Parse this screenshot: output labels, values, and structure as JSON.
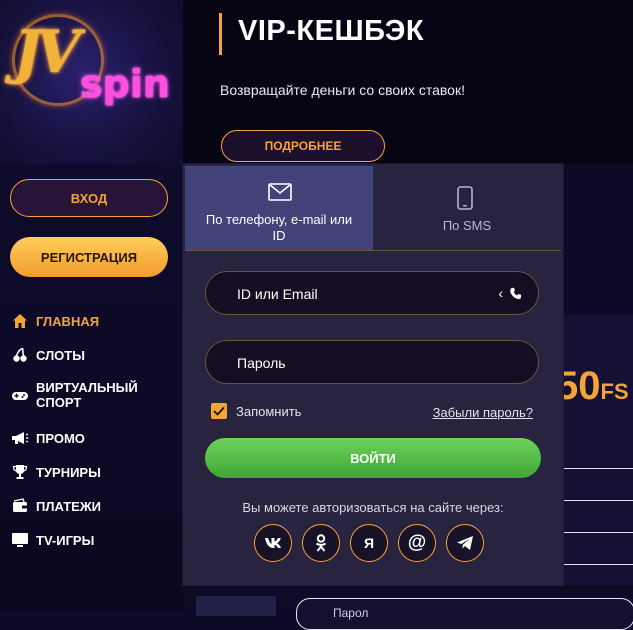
{
  "logo": {
    "letters": "JV",
    "word": "spin"
  },
  "banner": {
    "title": "VIP-КЕШБЭК",
    "text": "Возвращайте деньги со своих ставок!",
    "button": "ПОДРОБНЕЕ"
  },
  "sidebar": {
    "login": "ВХОД",
    "register": "РЕГИСТРАЦИЯ",
    "items": [
      {
        "label": "ГЛАВНАЯ",
        "icon": "home-icon"
      },
      {
        "label": "СЛОТЫ",
        "icon": "cherries-icon"
      },
      {
        "label": "ВИРТУАЛЬНЫЙ",
        "label2": "СПОРТ",
        "icon": "gamepad-icon"
      },
      {
        "label": "ПРОМО",
        "icon": "megaphone-icon"
      },
      {
        "label": "ТУРНИРЫ",
        "icon": "trophy-icon"
      },
      {
        "label": "ПЛАТЕЖИ",
        "icon": "wallet-icon"
      },
      {
        "label": "TV-ИГРЫ",
        "icon": "tv-icon"
      }
    ]
  },
  "modal": {
    "tabs": [
      {
        "line1": "По телефону, e-mail или",
        "line2": "ID"
      },
      {
        "label": "По SMS"
      }
    ],
    "id_placeholder": "ID или Email",
    "id_suffix": "‹",
    "password_placeholder": "Пароль",
    "remember": "Запомнить",
    "forgot": "Забыли пароль?",
    "submit": "ВОЙТИ",
    "social_text": "Вы можете авторизоваться на сайте через:",
    "socials": [
      "vk",
      "ok",
      "Я",
      "@",
      "telegram"
    ]
  },
  "promo": {
    "fs_number": "50",
    "fs_unit": "FS"
  },
  "bottom": {
    "field_text": "Парол"
  },
  "colors": {
    "accent": "#f3a434",
    "green": "#4fbd43",
    "modal_bg": "#28243f",
    "tab_active": "#424379"
  }
}
